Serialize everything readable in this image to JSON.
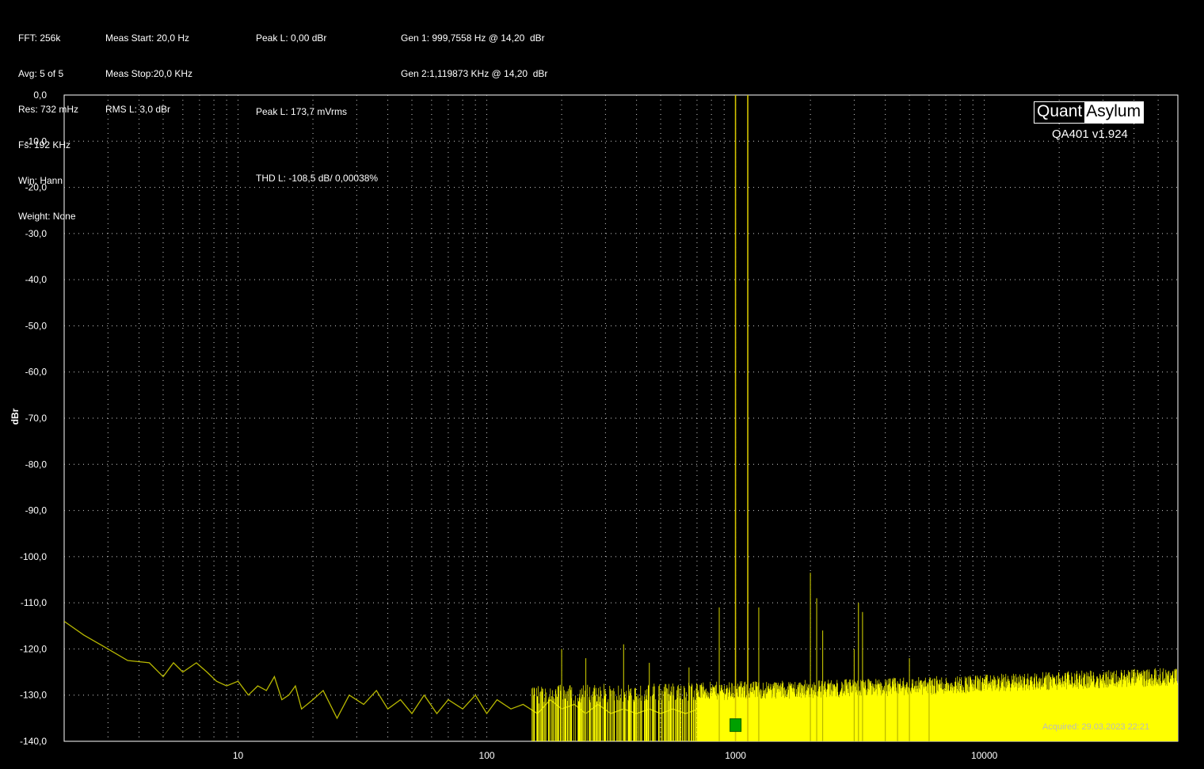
{
  "info": {
    "col1": [
      "FFT: 256k",
      "Avg: 5 of 5",
      "Res: 732 mHz",
      "Fs: 192 KHz",
      "Win: Hann",
      "Weight: None"
    ],
    "col2": [
      "Meas Start: 20,0 Hz",
      "Meas Stop:20,0 KHz",
      "RMS L: 3,0 dBr"
    ],
    "col3": [
      "Peak L: 0,00 dBr",
      "",
      "Peak L: 173,7 mVrms",
      "",
      "THD L: -108,5 dB/ 0,00038%"
    ],
    "col4": [
      "Gen 1: 999,7558 Hz @ 14,20  dBr",
      "Gen 2:1,119873 KHz @ 14,20  dBr"
    ]
  },
  "logo": {
    "part1": "Quant",
    "part2": "Asylum",
    "version": "QA401 v1.924"
  },
  "acquired": "Acquired: 29.03.2023  22:21",
  "colors": {
    "trace": "#ffff00",
    "trace_dim": "#b8b800",
    "background": "#000000",
    "grid": "#ffffff",
    "marker": "#00a000"
  },
  "chart_data": {
    "type": "line",
    "title": "",
    "xlabel": "",
    "ylabel": "dBr",
    "x_scale": "log",
    "xlim": [
      2,
      60000
    ],
    "ylim": [
      -140,
      0
    ],
    "x_ticks": [
      10,
      100,
      1000,
      10000
    ],
    "x_tick_labels": [
      "10",
      "100",
      "1000",
      "10000"
    ],
    "y_ticks": [
      0,
      -10,
      -20,
      -30,
      -40,
      -50,
      -60,
      -70,
      -80,
      -90,
      -100,
      -110,
      -120,
      -130,
      -140
    ],
    "y_tick_labels": [
      "0,0",
      "-10,0",
      "-20,0",
      "-30,0",
      "-40,0",
      "-50,0",
      "-60,0",
      "-70,0",
      "-80,0",
      "-90,0",
      "-100,0",
      "-110,0",
      "-120,0",
      "-130,0",
      "-140,0"
    ],
    "grid": true,
    "series": [
      {
        "x": [
          2,
          2.4,
          3,
          3.6,
          4.4,
          5,
          5.5,
          6,
          6.8,
          7.5,
          8.2,
          9,
          10,
          11,
          12,
          13,
          14,
          15,
          16,
          17,
          18,
          20,
          22,
          25,
          28,
          32,
          36,
          40,
          45,
          50,
          56,
          63,
          70,
          80,
          90,
          100,
          110,
          125,
          140,
          160,
          180,
          200,
          225,
          250,
          280,
          315,
          355,
          400,
          450,
          500,
          560,
          630,
          710,
          800,
          900
        ],
        "y": [
          -114,
          -117,
          -120,
          -122.5,
          -123,
          -126,
          -123,
          -125,
          -123,
          -125,
          -127,
          -128,
          -127,
          -130,
          -128,
          -129,
          -126,
          -131,
          -130,
          -128,
          -133,
          -131,
          -129,
          -135,
          -130,
          -132,
          -129,
          -133,
          -131,
          -134,
          -130,
          -134,
          -131,
          -133,
          -130,
          -134,
          -131,
          -133,
          -132,
          -134,
          -131,
          -133,
          -132,
          -134,
          -132,
          -134,
          -133,
          -134,
          -133,
          -134,
          -133,
          -134,
          -133,
          -134,
          -133
        ]
      }
    ],
    "noise_floor": [
      {
        "f": 1000,
        "y": -133
      },
      {
        "f": 3000,
        "y": -132.5
      },
      {
        "f": 10000,
        "y": -131.5
      },
      {
        "f": 30000,
        "y": -130.5
      },
      {
        "f": 60000,
        "y": -130
      }
    ],
    "peaks": [
      {
        "f": 200,
        "y": -120
      },
      {
        "f": 250,
        "y": -122
      },
      {
        "f": 355,
        "y": -119
      },
      {
        "f": 450,
        "y": -123
      },
      {
        "f": 650,
        "y": -124
      },
      {
        "f": 860,
        "y": -111
      },
      {
        "f": 999.76,
        "y": 0
      },
      {
        "f": 1119.87,
        "y": 0
      },
      {
        "f": 1240,
        "y": -111
      },
      {
        "f": 1999.5,
        "y": -103.5
      },
      {
        "f": 2119.6,
        "y": -109
      },
      {
        "f": 2239.7,
        "y": -116
      },
      {
        "f": 2999.3,
        "y": -120
      },
      {
        "f": 3119.4,
        "y": -110
      },
      {
        "f": 3239.5,
        "y": -112
      },
      {
        "f": 3999,
        "y": -127
      },
      {
        "f": 4480,
        "y": -127
      },
      {
        "f": 5000,
        "y": -122
      },
      {
        "f": 6000,
        "y": -127
      }
    ],
    "marker": {
      "f": 1000,
      "y": -136.5
    }
  }
}
